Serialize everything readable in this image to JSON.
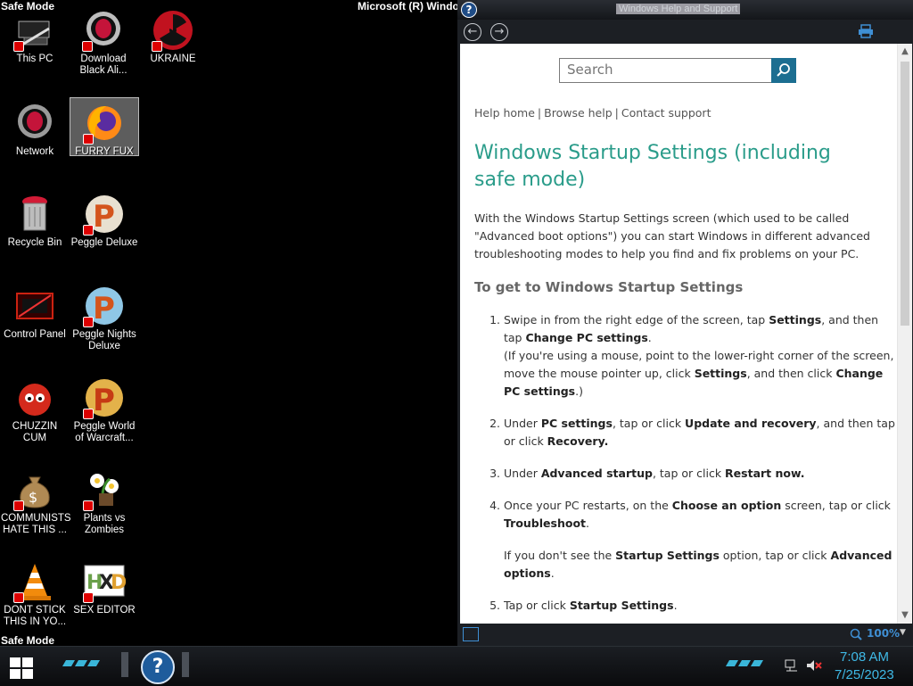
{
  "desktop": {
    "safe_mode_top": "Safe Mode",
    "safe_mode_bottom": "Safe Mode",
    "build_text": "Microsoft (R) Windows",
    "icons": [
      {
        "label": "This PC",
        "icon": "computer-icon"
      },
      {
        "label": "Download Black Ali...",
        "icon": "alienware-icon"
      },
      {
        "label": "UKRAINE",
        "icon": "radiation-icon"
      },
      {
        "label": "Network",
        "icon": "network-icon"
      },
      {
        "label": "FURRY FUX",
        "icon": "firefox-icon"
      },
      {
        "label": "Recycle Bin",
        "icon": "recycle-bin-icon"
      },
      {
        "label": "Peggle Deluxe",
        "icon": "peggle-icon"
      },
      {
        "label": "Control Panel",
        "icon": "control-panel-icon"
      },
      {
        "label": "Peggle Nights Deluxe",
        "icon": "peggle-nights-icon"
      },
      {
        "label": "CHUZZIN CUM",
        "icon": "chuzzle-icon"
      },
      {
        "label": "Peggle World of Warcraft...",
        "icon": "peggle-wow-icon"
      },
      {
        "label": "COMMUNISTS HATE THIS ...",
        "icon": "money-bag-icon"
      },
      {
        "label": "Plants vs Zombies",
        "icon": "plants-vs-zombies-icon"
      },
      {
        "label": "DONT STICK THIS IN YO...",
        "icon": "vlc-cone-icon"
      },
      {
        "label": "SEX EDITOR",
        "icon": "hxd-icon"
      }
    ]
  },
  "help_window": {
    "title": "Windows Help and Support",
    "search_placeholder": "Search",
    "links": [
      "Help home",
      "Browse help",
      "Contact support"
    ],
    "article_title": "Windows Startup Settings (including safe mode)",
    "intro": "With the Windows Startup Settings screen (which used to be called \"Advanced boot options\") you can start Windows in different advanced troubleshooting modes to help you find and fix problems on your PC.",
    "section_heading": "To get to Windows Startup Settings",
    "steps": {
      "s1_a": "Swipe in from the right edge of the screen, tap ",
      "s1_b": "Settings",
      "s1_c": ", and then tap ",
      "s1_d": "Change PC settings",
      "s1_e": ".",
      "s1_f": "(If you're using a mouse, point to the lower-right corner of the screen, move the mouse pointer up, click ",
      "s1_g": "Settings",
      "s1_h": ", and then click ",
      "s1_i": "Change PC settings",
      "s1_j": ".)",
      "s2_a": "Under ",
      "s2_b": "PC settings",
      "s2_c": ", tap or click ",
      "s2_d": "Update and recovery",
      "s2_e": ", and then tap or click ",
      "s2_f": "Recovery.",
      "s3_a": "Under ",
      "s3_b": "Advanced startup",
      "s3_c": ", tap or click ",
      "s3_d": "Restart now.",
      "s4_a": "Once your PC restarts, on the ",
      "s4_b": "Choose an option",
      "s4_c": " screen, tap or click ",
      "s4_d": "Troubleshoot",
      "s4_e": ".",
      "s4_f": "If you don't see the ",
      "s4_g": "Startup Settings",
      "s4_h": " option, tap or click ",
      "s4_i": "Advanced options",
      "s4_j": ".",
      "s5_a": "Tap or click ",
      "s5_b": "Startup Settings",
      "s5_c": "."
    },
    "zoom": "100%",
    "accent_color": "#2a9c8a"
  },
  "taskbar": {
    "time": "7:08 AM",
    "date": "7/25/2023",
    "pinned": [
      {
        "icon": "help-icon",
        "label": "?"
      }
    ]
  }
}
